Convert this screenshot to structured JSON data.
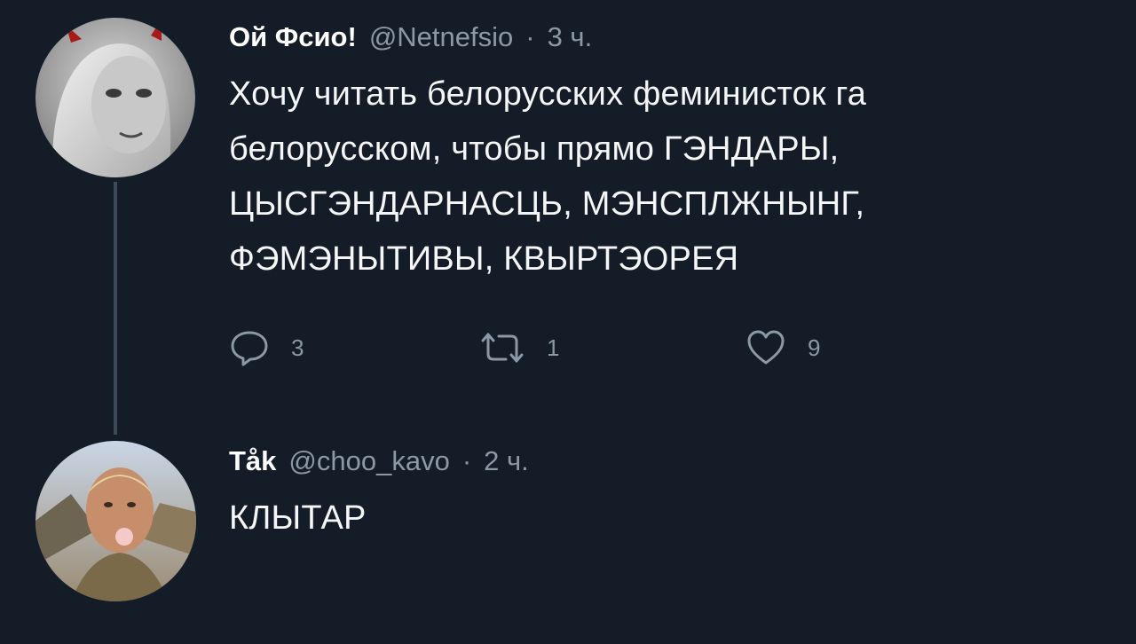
{
  "tweets": [
    {
      "display_name": "Ой Фсио!",
      "handle": "@Netnefsio",
      "separator": "·",
      "time": "3 ч.",
      "text_lines": [
        "Хочу читать белорусских феминисток га",
        "белорусском, чтобы прямо ГЭНДАРЫ,",
        "ЦЫСГЭНДАРНАСЦЬ, МЭНСПЛЖНЫНГ,",
        "ФЭМЭНЫТИВЫ, КВЫРТЭОРЕЯ"
      ],
      "actions": {
        "reply_icon": "reply-icon",
        "reply_count": "3",
        "retweet_icon": "retweet-icon",
        "retweet_count": "1",
        "like_icon": "heart-icon",
        "like_count": "9"
      }
    },
    {
      "display_name": "Tåk",
      "handle": "@choo_kavo",
      "separator": "·",
      "time": "2 ч.",
      "text": "КЛЫТАР"
    }
  ],
  "colors": {
    "background": "#141c27",
    "text": "#f4f6f7",
    "secondary_text": "#8b98a5",
    "thread_line": "#3d4a57"
  }
}
